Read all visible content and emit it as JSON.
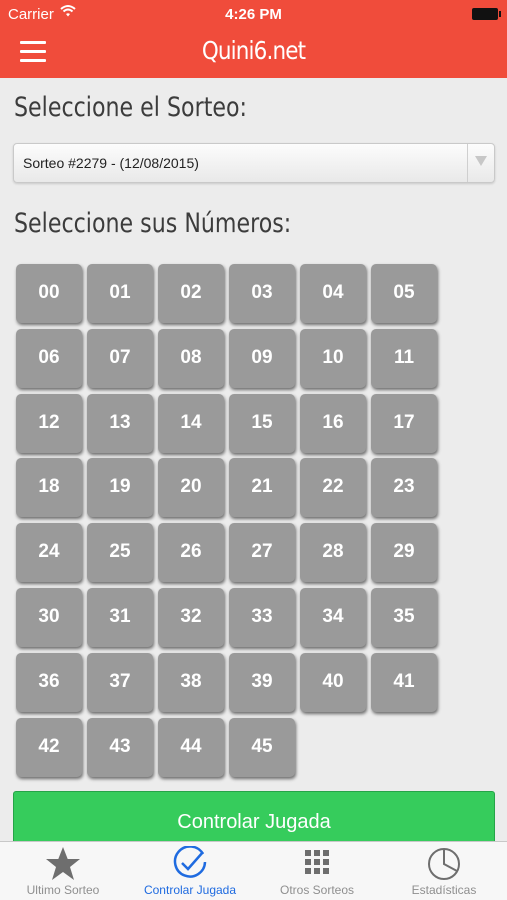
{
  "status_bar": {
    "carrier": "Carrier",
    "time": "4:26 PM"
  },
  "nav": {
    "title": "Quini6.net"
  },
  "sorteo_heading": "Seleccione el Sorteo:",
  "sorteo_select": {
    "value": "Sorteo #2279 - (12/08/2015)"
  },
  "numeros_heading": "Seleccione sus Números:",
  "numbers": [
    "00",
    "01",
    "02",
    "03",
    "04",
    "05",
    "06",
    "07",
    "08",
    "09",
    "10",
    "11",
    "12",
    "13",
    "14",
    "15",
    "16",
    "17",
    "18",
    "19",
    "20",
    "21",
    "22",
    "23",
    "24",
    "25",
    "26",
    "27",
    "28",
    "29",
    "30",
    "31",
    "32",
    "33",
    "34",
    "35",
    "36",
    "37",
    "38",
    "39",
    "40",
    "41",
    "42",
    "43",
    "44",
    "45"
  ],
  "action_button": "Controlar Jugada",
  "tabs": [
    {
      "label": "Ultimo Sorteo",
      "icon": "star-icon",
      "active": false
    },
    {
      "label": "Controlar Jugada",
      "icon": "check-circle-icon",
      "active": true
    },
    {
      "label": "Otros Sorteos",
      "icon": "grid-icon",
      "active": false
    },
    {
      "label": "Estadísticas",
      "icon": "pie-chart-icon",
      "active": false
    }
  ],
  "colors": {
    "header": "#f04c3b",
    "number_button": "#9a9a9a",
    "action_button": "#36cc5c",
    "tab_active": "#1f6be0",
    "tab_inactive": "#8f8f8f"
  }
}
